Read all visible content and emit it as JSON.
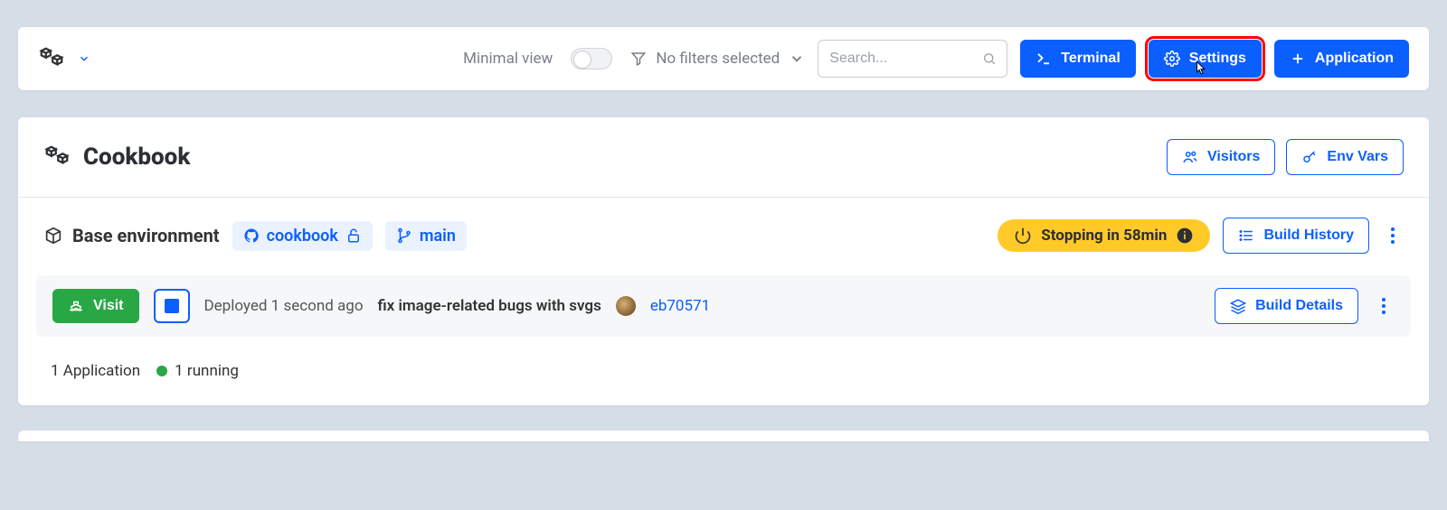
{
  "toolbar": {
    "minimal_view_label": "Minimal view",
    "filters_label": "No filters selected",
    "search_placeholder": "Search...",
    "terminal_label": "Terminal",
    "settings_label": "Settings",
    "application_label": "Application"
  },
  "project": {
    "name": "Cookbook",
    "visitors_label": "Visitors",
    "envvars_label": "Env Vars"
  },
  "environment": {
    "name": "Base environment",
    "repo": "cookbook",
    "branch": "main",
    "status": "Stopping in 58min",
    "build_history_label": "Build History"
  },
  "deployment": {
    "visit_label": "Visit",
    "deployed_text": "Deployed 1 second ago",
    "commit_message": "fix image-related bugs with svgs",
    "commit_hash": "eb70571",
    "build_details_label": "Build Details"
  },
  "footer": {
    "app_count": "1 Application",
    "running_text": "1 running"
  }
}
